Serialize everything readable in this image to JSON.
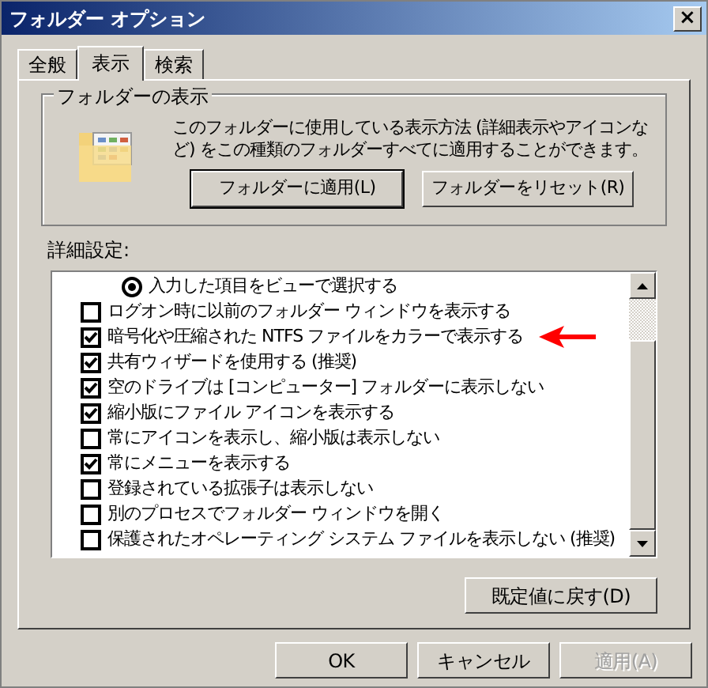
{
  "window": {
    "title": "フォルダー オプション",
    "close": "×"
  },
  "tabs": [
    {
      "label": "全般",
      "selected": false
    },
    {
      "label": "表示",
      "selected": true
    },
    {
      "label": "検索",
      "selected": false
    }
  ],
  "folder_view": {
    "legend": "フォルダーの表示",
    "description": "このフォルダーに使用している表示方法 (詳細表示やアイコンなど) をこの種類のフォルダーすべてに適用することができます。",
    "buttons": [
      {
        "label": "フォルダーに適用(L)",
        "default": true
      },
      {
        "label": "フォルダーをリセット(R)",
        "default": false
      }
    ]
  },
  "advanced": {
    "label": "詳細設定:",
    "items": [
      {
        "kind": "radio",
        "label": "入力した項目をビューで選択する",
        "checked": true,
        "marked": false
      },
      {
        "kind": "checkbox",
        "label": "ログオン時に以前のフォルダー ウィンドウを表示する",
        "checked": false,
        "marked": false
      },
      {
        "kind": "checkbox",
        "label": "暗号化や圧縮された NTFS ファイルをカラーで表示する",
        "checked": true,
        "marked": true
      },
      {
        "kind": "checkbox",
        "label": "共有ウィザードを使用する (推奨)",
        "checked": true,
        "marked": false
      },
      {
        "kind": "checkbox",
        "label": "空のドライブは [コンピューター] フォルダーに表示しない",
        "checked": true,
        "marked": false
      },
      {
        "kind": "checkbox",
        "label": "縮小版にファイル アイコンを表示する",
        "checked": true,
        "marked": false
      },
      {
        "kind": "checkbox",
        "label": "常にアイコンを表示し、縮小版は表示しない",
        "checked": false,
        "marked": false
      },
      {
        "kind": "checkbox",
        "label": "常にメニューを表示する",
        "checked": true,
        "marked": false
      },
      {
        "kind": "checkbox",
        "label": "登録されている拡張子は表示しない",
        "checked": false,
        "marked": false
      },
      {
        "kind": "checkbox",
        "label": "別のプロセスでフォルダー ウィンドウを開く",
        "checked": false,
        "marked": false
      },
      {
        "kind": "checkbox",
        "label": "保護されたオペレーティング システム ファイルを表示しない (推奨)",
        "checked": false,
        "marked": false
      }
    ],
    "restore_button": "既定値に戻す(D)"
  },
  "buttons": [
    {
      "label": "OK",
      "disabled": false
    },
    {
      "label": "キャンセル",
      "disabled": false
    },
    {
      "label": "適用(A)",
      "disabled": true
    }
  ]
}
